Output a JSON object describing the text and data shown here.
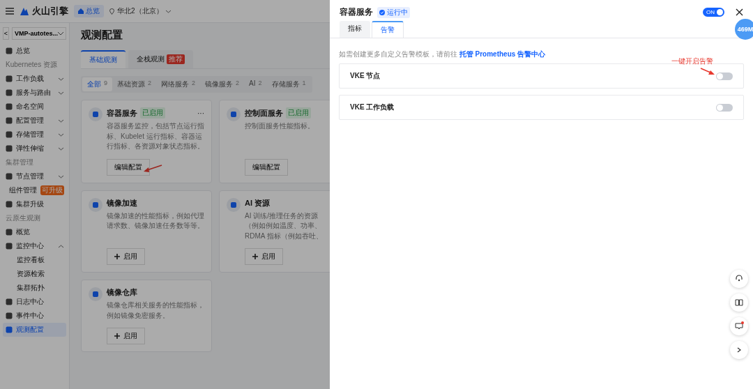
{
  "topbar": {
    "logo": "火山引擎",
    "home_chip": "总览",
    "region": "华北2（北京）"
  },
  "sidebar": {
    "back": "<",
    "cluster": "VMP-autotes...",
    "items": [
      {
        "kind": "item",
        "label": "总览",
        "selected": false
      },
      {
        "kind": "header",
        "label": "Kubernetes 资源"
      },
      {
        "kind": "item",
        "label": "工作负载",
        "expanded": false,
        "selected": false
      },
      {
        "kind": "item",
        "label": "服务与路由",
        "expanded": false,
        "selected": false
      },
      {
        "kind": "item",
        "label": "命名空间",
        "selected": false
      },
      {
        "kind": "item",
        "label": "配置管理",
        "expanded": false,
        "selected": false
      },
      {
        "kind": "item",
        "label": "存储管理",
        "expanded": false,
        "selected": false
      },
      {
        "kind": "item",
        "label": "弹性伸缩",
        "expanded": false,
        "selected": false
      },
      {
        "kind": "header",
        "label": "集群管理"
      },
      {
        "kind": "item",
        "label": "节点管理",
        "expanded": false,
        "selected": false
      },
      {
        "kind": "item",
        "label": "组件管理",
        "badge": "可升级",
        "selected": false
      },
      {
        "kind": "item",
        "label": "集群升级",
        "selected": false
      },
      {
        "kind": "header",
        "label": "云原生观测"
      },
      {
        "kind": "item",
        "label": "概览",
        "selected": false
      },
      {
        "kind": "item",
        "label": "监控中心",
        "expanded": true,
        "selected": false,
        "children": [
          {
            "label": "监控看板",
            "selected": false
          },
          {
            "label": "资源检索",
            "selected": false
          },
          {
            "label": "集群拓扑",
            "selected": false
          }
        ]
      },
      {
        "kind": "item",
        "label": "日志中心",
        "selected": false
      },
      {
        "kind": "item",
        "label": "事件中心",
        "selected": false
      },
      {
        "kind": "item",
        "label": "观测配置",
        "selected": true
      }
    ]
  },
  "main": {
    "title": "观测配置",
    "tabs": [
      {
        "label": "基础观测",
        "selected": true
      },
      {
        "label": "全栈观测",
        "badge": "推荐",
        "selected": false
      }
    ],
    "filters": [
      {
        "label": "全部",
        "count": "9",
        "selected": true
      },
      {
        "label": "基础资源",
        "count": "2",
        "selected": false
      },
      {
        "label": "网络服务",
        "count": "2",
        "selected": false
      },
      {
        "label": "镜像服务",
        "count": "2",
        "selected": false
      },
      {
        "label": "AI",
        "count": "2",
        "selected": false
      },
      {
        "label": "存储服务",
        "count": "1",
        "selected": false
      }
    ],
    "cards": [
      {
        "title": "容器服务",
        "status": "已启用",
        "more": "···",
        "description": "容器服务监控，包括节点运行指标、Kubelet 运行指标、容器运行指标、各资源对象状态指标。",
        "button": {
          "kind": "edit",
          "label": "编辑配置"
        }
      },
      {
        "title": "控制面服务",
        "status": "已启用",
        "description": "控制面服务性能指标。",
        "button": {
          "kind": "edit",
          "label": "编辑配置"
        }
      },
      {
        "title": "镜像加速",
        "description": "镜像加速的性能指标，例如代理请求数、镜像加速任务数等等。",
        "button": {
          "kind": "enable",
          "label": "启用"
        }
      },
      {
        "title": "AI 资源",
        "description_lines": [
          "AI 训练/推理任务的资源",
          "（例如例如温度、功率、",
          "RDMA 指标（例如吞吐、"
        ],
        "button": {
          "kind": "enable",
          "label": "启用"
        }
      },
      {
        "title": "镜像仓库",
        "description": "镜像仓库相关服务的性能指标，例如镜像免密服务。",
        "button": {
          "kind": "enable",
          "label": "启用"
        }
      }
    ],
    "annotation": true
  },
  "drawer": {
    "title": "容器服务",
    "status": "运行中",
    "switch": {
      "label": "ON",
      "on": true
    },
    "memory_badge": "469M",
    "tabs": [
      {
        "label": "指标",
        "selected": false
      },
      {
        "label": "告警",
        "selected": true
      }
    ],
    "info": "如需创建更多自定义告警模板，请前往",
    "info_link": "托管 Prometheus 告警中心",
    "annotation": "一键开启告警",
    "alerts": [
      {
        "label": "VKE 节点",
        "on": false
      },
      {
        "label": "VKE 工作负载",
        "on": false
      }
    ]
  },
  "float_buttons": [
    {
      "kind": "headset"
    },
    {
      "kind": "book"
    },
    {
      "kind": "message",
      "dot": true
    },
    {
      "kind": "chevron"
    }
  ]
}
